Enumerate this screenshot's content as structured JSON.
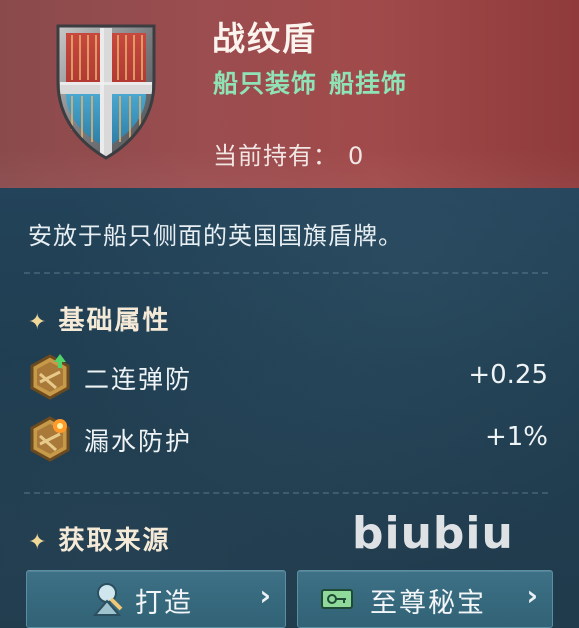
{
  "item": {
    "name": "战纹盾",
    "tags": [
      "船只装饰",
      "船挂饰"
    ],
    "owned_label": "当前持有：",
    "owned_count": "0",
    "description": "安放于船只侧面的英国国旗盾牌。"
  },
  "attributes": {
    "title": "基础属性",
    "rows": [
      {
        "label": "二连弹防",
        "value": "+0.25"
      },
      {
        "label": "漏水防护",
        "value": "+1%"
      }
    ]
  },
  "sources": {
    "title": "获取来源",
    "buttons": [
      {
        "label": "打造",
        "icon": "anchor-craft-icon"
      },
      {
        "label": "至尊秘宝",
        "icon": "ticket-icon"
      }
    ]
  },
  "watermark": "biubiu",
  "colors": {
    "header_bg": "#9b4d4f",
    "panel_bg": "#203c4d",
    "tag_green": "#8fe3b6",
    "button_bg": "#3a6c81"
  }
}
